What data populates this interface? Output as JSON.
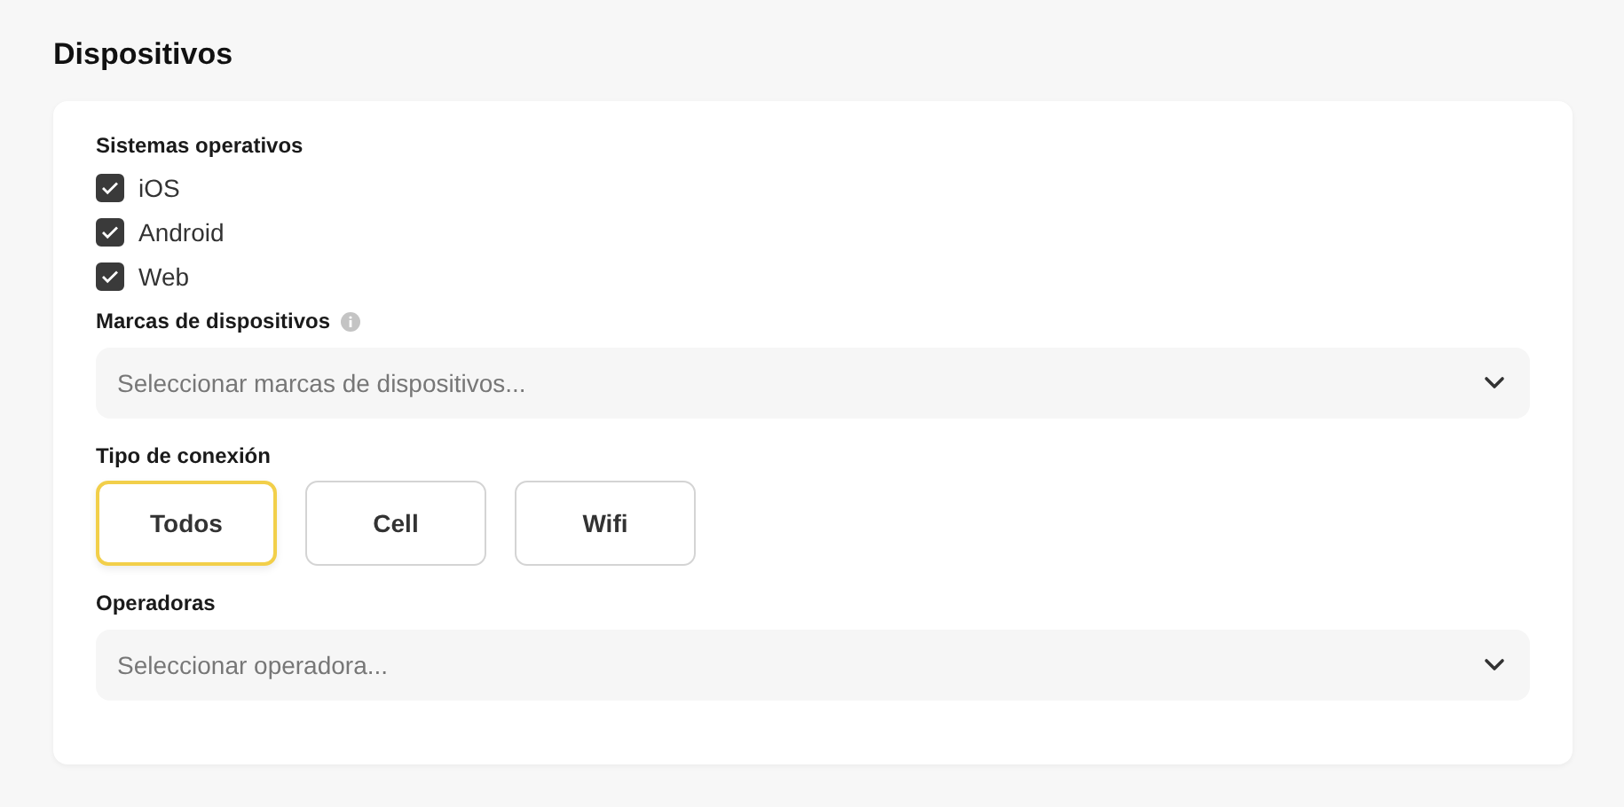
{
  "title": "Dispositivos",
  "os": {
    "label": "Sistemas operativos",
    "options": [
      {
        "label": "iOS",
        "checked": true
      },
      {
        "label": "Android",
        "checked": true
      },
      {
        "label": "Web",
        "checked": true
      }
    ]
  },
  "brands": {
    "label": "Marcas de dispositivos",
    "placeholder": "Seleccionar marcas de dispositivos..."
  },
  "connection": {
    "label": "Tipo de conexión",
    "options": [
      {
        "label": "Todos",
        "selected": true
      },
      {
        "label": "Cell",
        "selected": false
      },
      {
        "label": "Wifi",
        "selected": false
      }
    ]
  },
  "carriers": {
    "label": "Operadoras",
    "placeholder": "Seleccionar operadora..."
  }
}
